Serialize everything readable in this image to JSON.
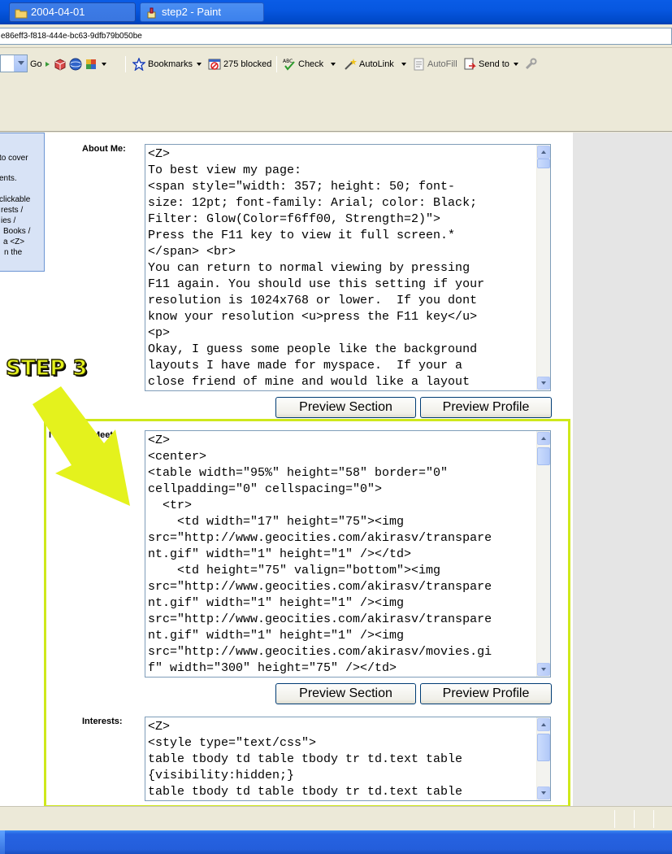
{
  "browser": {
    "address_text": "e86eff3-f818-444e-bc63-9dfb79b050be",
    "go_label": "Go",
    "bookmarks_label": "Bookmarks",
    "blocked_label": "275 blocked",
    "check_label": "Check",
    "autolink_label": "AutoLink",
    "autofill_label": "AutoFill",
    "sendto_label": "Send to"
  },
  "sidebar": {
    "lines": [
      "to cover",
      "",
      "ents.",
      "",
      "clickable",
      "rests /",
      "ies /",
      "Books /",
      "a <Z>",
      "n the"
    ]
  },
  "annotation": {
    "step_label": "STEP 3",
    "highlight_color": "#cfe81b",
    "arrow_color": "#e4f21d"
  },
  "sections": {
    "about": {
      "label": "About Me:",
      "text": "<Z>\nTo best view my page:\n<span style=\"width: 357; height: 50; font-\nsize: 12pt; font-family: Arial; color: Black;\nFilter: Glow(Color=f6ff00, Strength=2)\">\nPress the F11 key to view it full screen.*\n</span> <br>\nYou can return to normal viewing by pressing\nF11 again. You should use this setting if your\nresolution is 1024x768 or lower.  If you dont\nknow your resolution <u>press the F11 key</u>\n<p>\nOkay, I guess some people like the background\nlayouts I have made for myspace.  If your a\nclose friend of mine and would like a layout"
    },
    "meet": {
      "label": "I'd Like to Meet:",
      "text": "<Z>\n<center>\n<table width=\"95%\" height=\"58\" border=\"0\"\ncellpadding=\"0\" cellspacing=\"0\">\n  <tr>\n    <td width=\"17\" height=\"75\"><img\nsrc=\"http://www.geocities.com/akirasv/transpare\nnt.gif\" width=\"1\" height=\"1\" /></td>\n    <td height=\"75\" valign=\"bottom\"><img\nsrc=\"http://www.geocities.com/akirasv/transpare\nnt.gif\" width=\"1\" height=\"1\" /><img\nsrc=\"http://www.geocities.com/akirasv/transpare\nnt.gif\" width=\"1\" height=\"1\" /><img\nsrc=\"http://www.geocities.com/akirasv/movies.gi\nf\" width=\"300\" height=\"75\" /></td>"
    },
    "interests": {
      "label": "Interests:",
      "text": "<Z>\n<style type=\"text/css\">\ntable tbody td table tbody tr td.text table\n{visibility:hidden;}\ntable tbody td table tbody tr td.text table"
    },
    "preview_section_label": "Preview Section",
    "preview_profile_label": "Preview Profile"
  },
  "taskbar": {
    "items": [
      {
        "label": "2004-04-01"
      },
      {
        "label": "step2 - Paint"
      }
    ]
  }
}
